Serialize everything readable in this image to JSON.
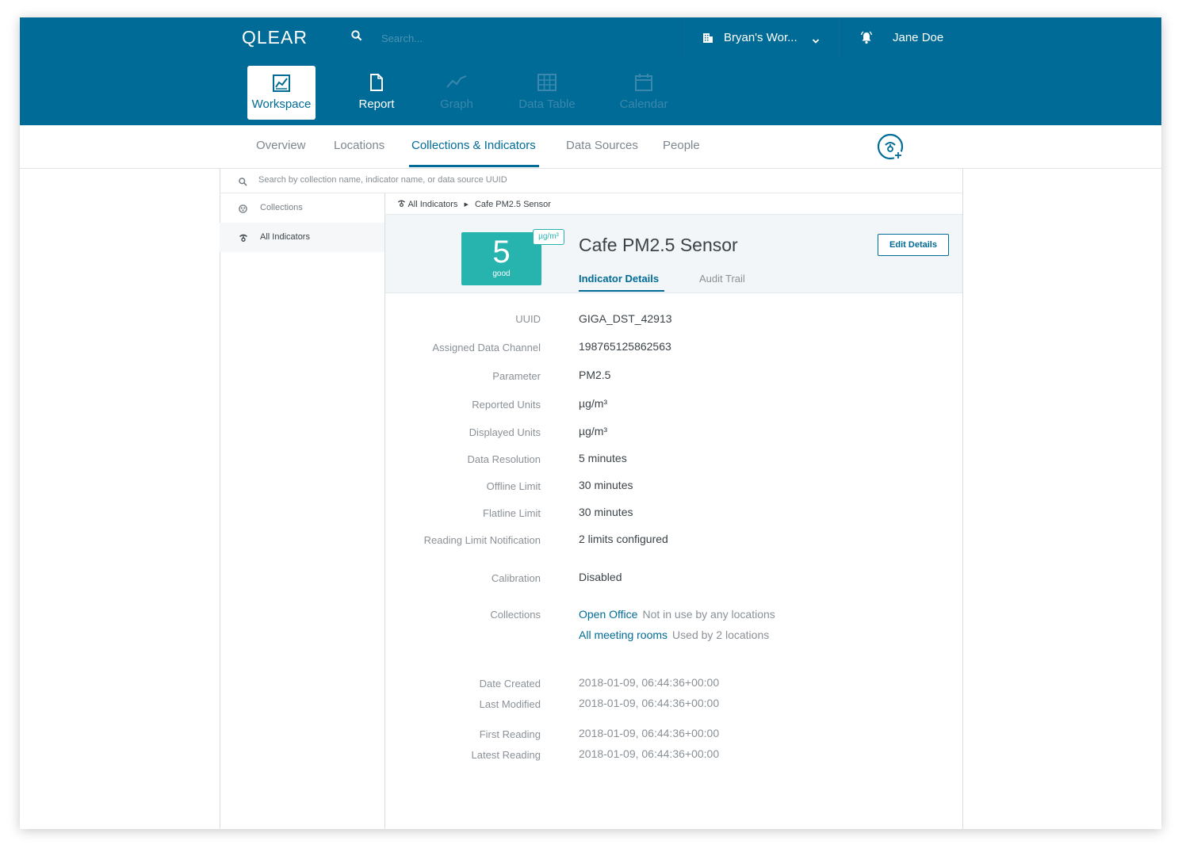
{
  "app": {
    "logo": "QLEAR",
    "search_placeholder": "Search...",
    "workspace_name": "Bryan's Wor...",
    "user_name": "Jane Doe"
  },
  "main_nav": [
    {
      "label": "Workspace",
      "icon": "workspace-icon",
      "state": "active"
    },
    {
      "label": "Report",
      "icon": "report-icon",
      "state": "enabled"
    },
    {
      "label": "Graph",
      "icon": "graph-icon",
      "state": "disabled"
    },
    {
      "label": "Data Table",
      "icon": "data-table-icon",
      "state": "disabled"
    },
    {
      "label": "Calendar",
      "icon": "calendar-icon",
      "state": "disabled"
    }
  ],
  "sub_tabs": [
    "Overview",
    "Locations",
    "Collections & Indicators",
    "Data Sources",
    "People"
  ],
  "active_sub_tab": "Collections & Indicators",
  "content_search_placeholder": "Search by collection name, indicator name, or data source UUID",
  "sidebar": {
    "items": [
      {
        "label": "Collections",
        "icon": "collections-icon"
      },
      {
        "label": "All Indicators",
        "icon": "indicator-icon"
      }
    ],
    "active": "All Indicators"
  },
  "breadcrumb": {
    "root": "All Indicators",
    "current": "Cafe PM2.5 Sensor"
  },
  "indicator": {
    "value": "5",
    "status": "good",
    "unit": "µg/m³",
    "name": "Cafe PM2.5 Sensor",
    "edit_label": "Edit Details",
    "tabs": [
      "Indicator Details",
      "Audit Trail"
    ],
    "active_tab": "Indicator Details"
  },
  "details": {
    "uuid": {
      "label": "UUID",
      "value": "GIGA_DST_42913"
    },
    "channel": {
      "label": "Assigned Data Channel",
      "value": "198765125862563"
    },
    "parameter": {
      "label": "Parameter",
      "value": "PM2.5"
    },
    "reported_units": {
      "label": "Reported Units",
      "value": "µg/m³"
    },
    "displayed_units": {
      "label": "Displayed Units",
      "value": "µg/m³"
    },
    "resolution": {
      "label": "Data Resolution",
      "value": "5 minutes"
    },
    "offline": {
      "label": "Offline Limit",
      "value": "30 minutes"
    },
    "flatline": {
      "label": "Flatline Limit",
      "value": "30 minutes"
    },
    "reading_limit": {
      "label": "Reading Limit Notification",
      "value": "2 limits configured"
    },
    "calibration": {
      "label": "Calibration",
      "value": "Disabled"
    },
    "collections_label": "Collections",
    "collections": [
      {
        "name": "Open Office",
        "note": "Not in use by any locations"
      },
      {
        "name": "All meeting rooms",
        "note": "Used by 2 locations"
      }
    ],
    "date_created": {
      "label": "Date Created",
      "value": "2018-01-09, 06:44:36+00:00"
    },
    "last_modified": {
      "label": "Last Modified",
      "value": "2018-01-09, 06:44:36+00:00"
    },
    "first_reading": {
      "label": "First Reading",
      "value": "2018-01-09, 06:44:36+00:00"
    },
    "latest_reading": {
      "label": "Latest Reading",
      "value": "2018-01-09, 06:44:36+00:00"
    }
  },
  "colors": {
    "brand": "#006b96",
    "good": "#27b3ae"
  }
}
